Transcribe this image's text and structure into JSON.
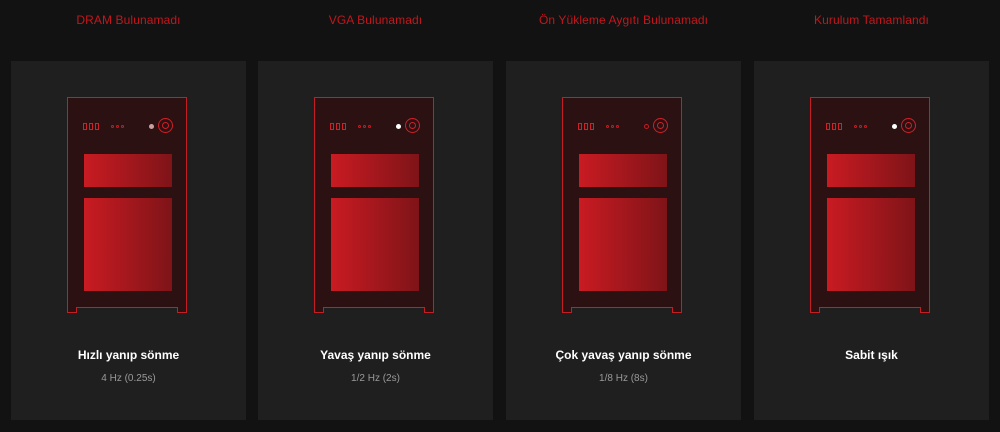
{
  "statuses": [
    {
      "title": "DRAM Bulunamadı",
      "pattern": "Hızlı yanıp sönme",
      "frequency": "4 Hz (0.25s)"
    },
    {
      "title": "VGA Bulunamadı",
      "pattern": "Yavaş yanıp sönme",
      "frequency": "1/2 Hz (2s)"
    },
    {
      "title": "Ön Yükleme Aygıtı Bulunamadı",
      "pattern": "Çok yavaş yanıp sönme",
      "frequency": "1/8 Hz (8s)"
    },
    {
      "title": "Kurulum Tamamlandı",
      "pattern": "Sabit ışık",
      "frequency": ""
    }
  ],
  "colors": {
    "accent": "#c4161c",
    "led_on": "#ffffff",
    "led_dim": "#c9a0a0",
    "led_off": "#c41d24"
  },
  "icons": [
    "pc-case-icon",
    "power-button-icon",
    "status-led-icon"
  ]
}
